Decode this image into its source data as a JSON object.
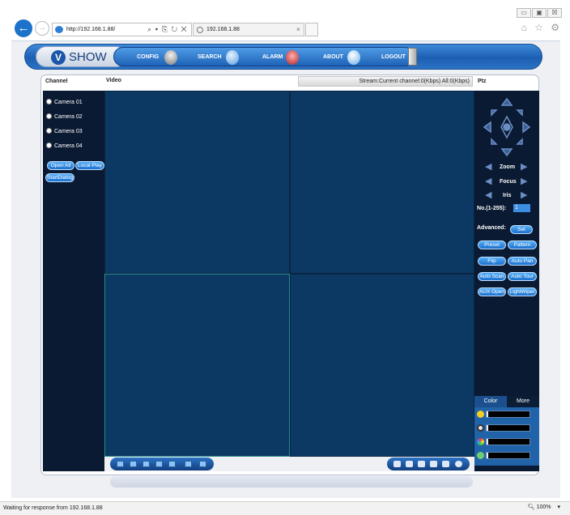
{
  "browser": {
    "url": "http://192.168.1.88/",
    "address_buttons": "⌕ ▾ ⎘ ↻ ✕",
    "tab_title": "192.168.1.88",
    "tab_close": "×",
    "window_controls": [
      "▭",
      "▣",
      "☒"
    ],
    "right_tools": "⌂ ☆ ⚙",
    "status_text": "Waiting for response from 192.168.1.88",
    "zoom": "100%",
    "zoom_arrow": "▾"
  },
  "app": {
    "logo": "SHOW",
    "logo_letter": "V",
    "menu": [
      "CONFIG",
      "SEARCH",
      "ALARM",
      "ABOUT",
      "LOGOUT"
    ]
  },
  "panels": {
    "channel_header": "Channel",
    "video_header": "Video",
    "stream_status": "Stream:Current channel:0(Kbps) All:0(Kbps)",
    "ptz_header": "Ptz"
  },
  "channels": {
    "cameras": [
      "Camera 01",
      "Camera 02",
      "Camera 03",
      "Camera 04"
    ],
    "buttons": [
      "Open All",
      "Local Play",
      "StartDialog"
    ]
  },
  "ptz": {
    "zoom_label": "Zoom",
    "focus_label": "Focus",
    "iris_label": "Iris",
    "preset_no_label": "No.(1-255):",
    "preset_no_value": "1",
    "advanced_label": "Advanced:",
    "set_button": "Set",
    "buttons": [
      "Preset",
      "Pattern",
      "Flip",
      "Auto Pan",
      "Auto Scan",
      "Auto Tour",
      "AUX Open",
      "LightWiper"
    ]
  },
  "color_panel": {
    "tabs": [
      "Color",
      "More"
    ],
    "sliders": [
      "brightness",
      "contrast",
      "saturation",
      "hue"
    ]
  },
  "colors": {
    "panel_dark": "#0b1a33",
    "video_cell": "#0c3963",
    "accent_blue": "#1c6fcd"
  }
}
